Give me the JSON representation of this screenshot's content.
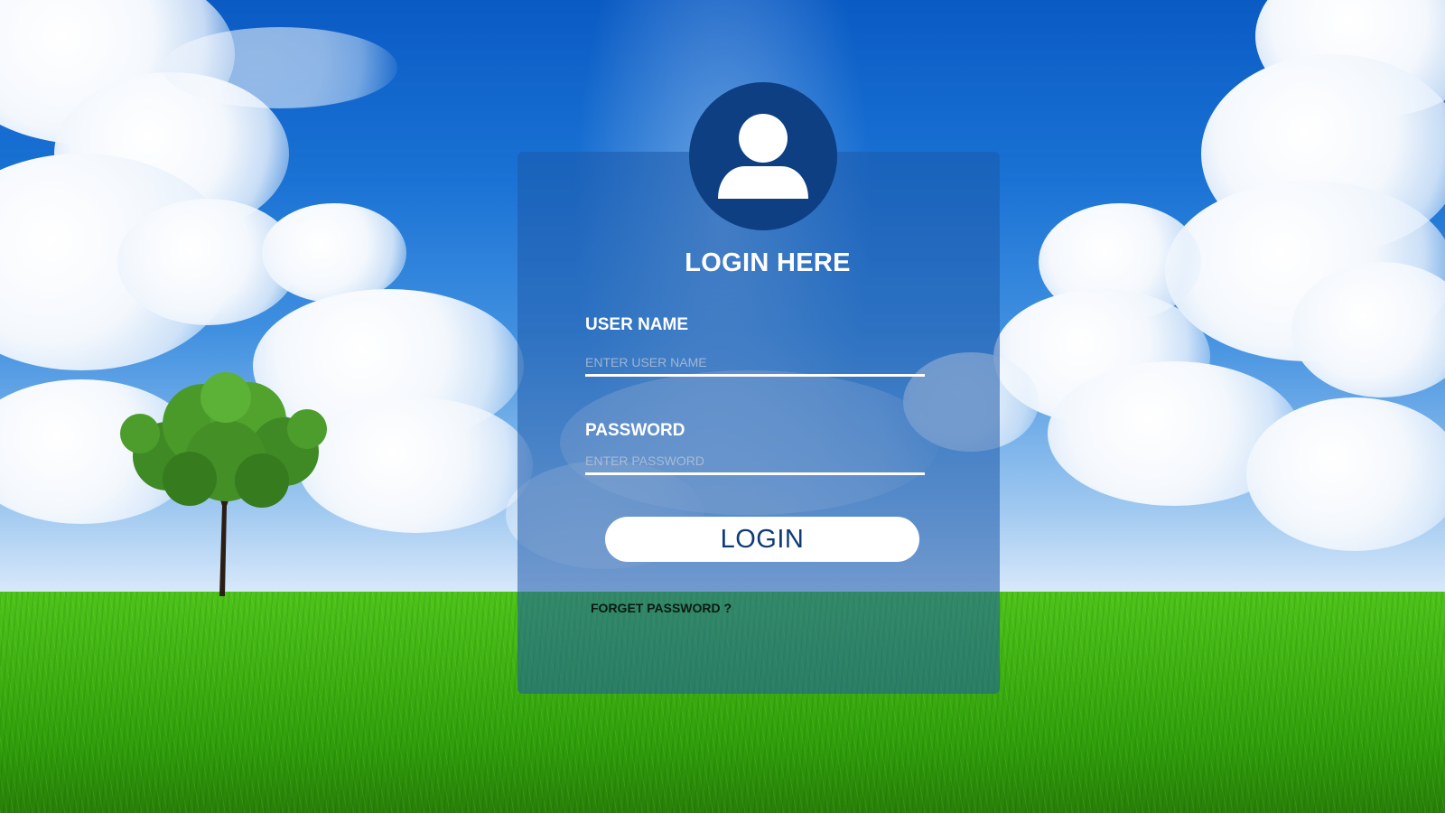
{
  "form": {
    "title": "LOGIN HERE",
    "username_label": "USER NAME",
    "username_placeholder": "ENTER USER NAME",
    "password_label": "PASSWORD",
    "password_placeholder": "ENTER PASSWORD",
    "login_button": "LOGIN",
    "forgot_link": "FORGET PASSWORD ?"
  },
  "icons": {
    "avatar": "user-icon"
  },
  "colors": {
    "avatar_bg": "#0d3f82",
    "button_text": "#0d3a78",
    "card_tint": "rgba(30, 90, 170, 0.55)"
  }
}
